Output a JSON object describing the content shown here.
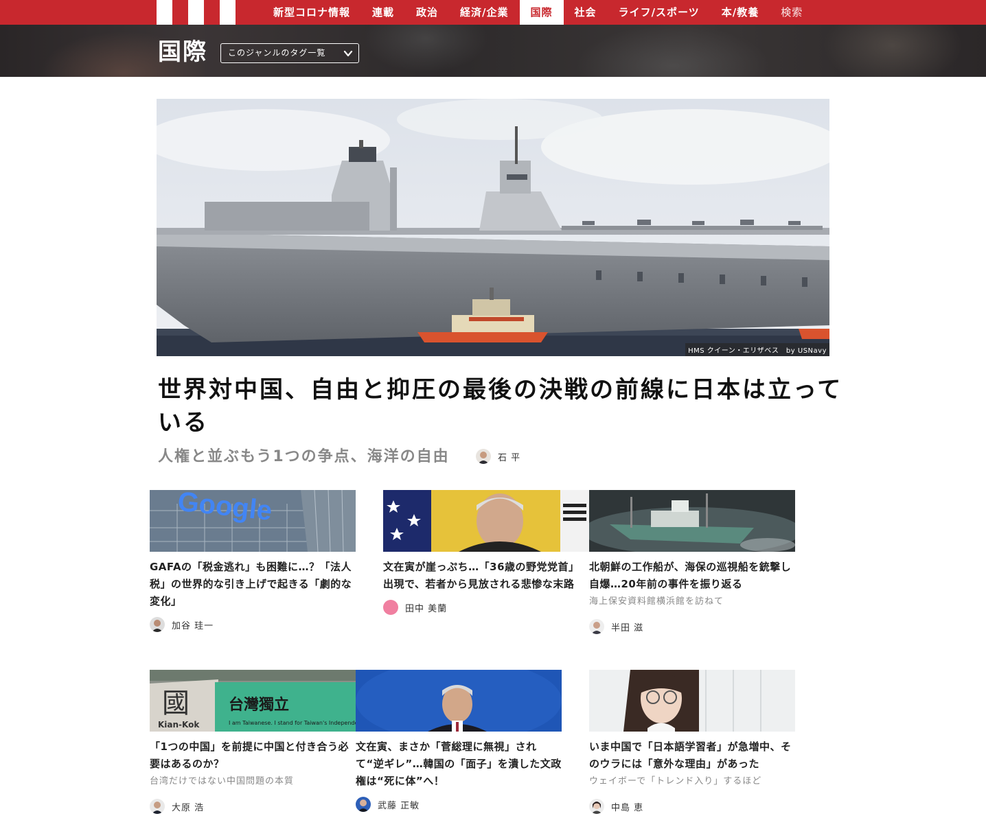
{
  "nav": {
    "items": [
      {
        "label": "新型コロナ情報",
        "active": false
      },
      {
        "label": "連載",
        "active": false
      },
      {
        "label": "政治",
        "active": false
      },
      {
        "label": "経済/企業",
        "active": false
      },
      {
        "label": "国際",
        "active": true
      },
      {
        "label": "社会",
        "active": false
      },
      {
        "label": "ライフ/スポーツ",
        "active": false
      },
      {
        "label": "本/教養",
        "active": false
      }
    ],
    "search_label": "検索"
  },
  "genre": {
    "title": "国際",
    "tag_select_label": "このジャンルのタグ一覧"
  },
  "hero": {
    "image_credit": "HMS クイーン・エリザベス　by USNavy",
    "title": "世界対中国、自由と抑圧の最後の決戦の前線に日本は立っている",
    "subtitle": "人権と並ぶもう1つの争点、海洋の自由",
    "author": "石 平"
  },
  "articles": [
    {
      "title": "GAFAの「税金逃れ」も困難に…？「法人税」の世界的な引き上げで起きる「劇的な変化」",
      "subtitle": "",
      "author": "加谷 珪一"
    },
    {
      "title": "文在寅が崖っぷち…「36歳の野党党首」出現で、若者から見放される悲惨な末路",
      "subtitle": "",
      "author": "田中 美蘭"
    },
    {
      "title": "北朝鮮の工作船が、海保の巡視船を銃撃し自爆…20年前の事件を振り返る",
      "subtitle": "海上保安資料館横浜館を訪ねて",
      "author": "半田 滋"
    },
    {
      "title": "「1つの中国」を前提に中国と付き合う必要はあるのか？",
      "subtitle": "台湾だけではない中国問題の本質",
      "author": "大原 浩"
    },
    {
      "title": "文在寅、まさか「菅総理に無視」されて“逆ギレ”…韓国の「面子」を潰した文政権は“死に体”へ！",
      "subtitle": "",
      "author": "武藤 正敏"
    },
    {
      "title": "いま中国で「日本語学習者」が急増中、そのウラには「意外な理由」があった",
      "subtitle": "ウェイボーで「トレンド入り」するほど",
      "author": "中島 恵"
    }
  ],
  "thumb_text": {
    "google": "Google",
    "taiwan_banner": "台灣獨立",
    "taiwan_banner_en": "I am Taiwanese. I stand for Taiwan's Independence",
    "kanji": "國",
    "kian": "Kian-Kok"
  },
  "icons": {
    "logo": "site-logo-stripes",
    "tag_chevron": "chevron-down-icon"
  },
  "colors": {
    "brand_red": "#c8282e"
  }
}
